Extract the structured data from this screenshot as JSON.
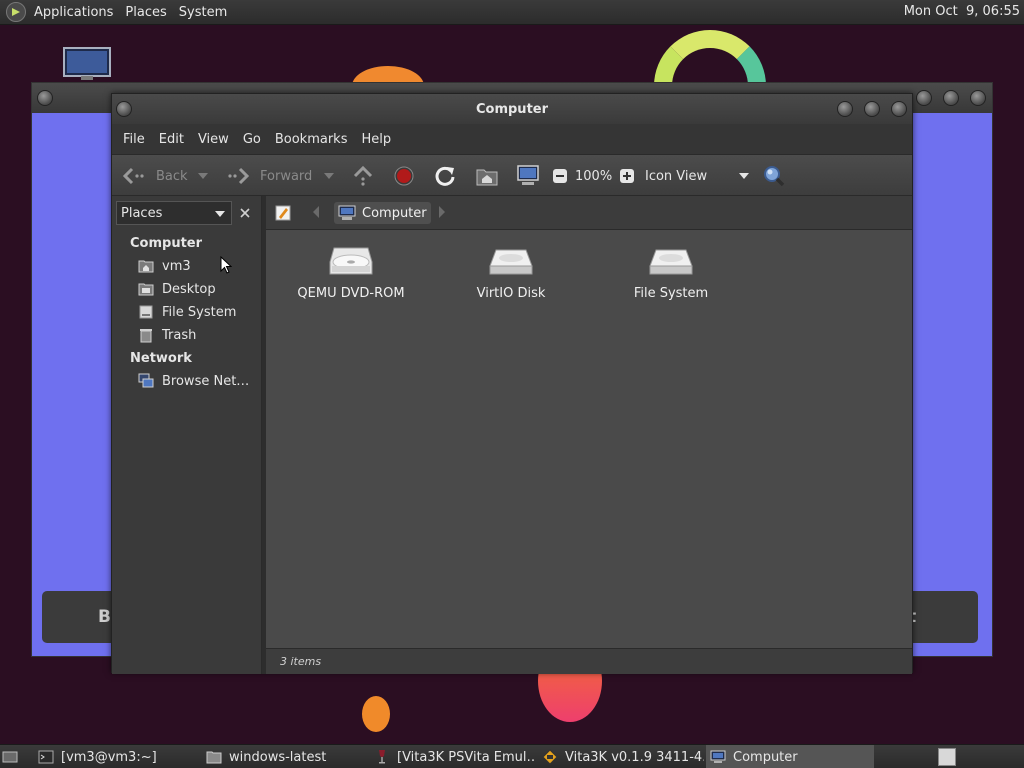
{
  "top_panel": {
    "menus": [
      "Applications",
      "Places",
      "System"
    ],
    "clock": "Mon Oct  9, 06:55"
  },
  "background_window": {
    "left_button_text": "B",
    "right_button_text": "t"
  },
  "window": {
    "title": "Computer",
    "menu": [
      "File",
      "Edit",
      "View",
      "Go",
      "Bookmarks",
      "Help"
    ],
    "toolbar": {
      "back": "Back",
      "forward": "Forward",
      "zoom": "100%",
      "view_mode": "Icon View"
    },
    "sidebar": {
      "selector": "Places",
      "sections": [
        {
          "heading": "Computer",
          "items": [
            "vm3",
            "Desktop",
            "File System",
            "Trash"
          ]
        },
        {
          "heading": "Network",
          "items": [
            "Browse Net…"
          ]
        }
      ]
    },
    "location": {
      "crumb": "Computer"
    },
    "files": [
      "QEMU DVD-ROM",
      "VirtIO Disk",
      "File System"
    ],
    "status": "3 items"
  },
  "taskbar": {
    "tasks": [
      "[vm3@vm3:~]",
      "windows-latest",
      "[Vita3K PSVita Emul…",
      "Vita3K v0.1.9 3411-4…",
      "Computer"
    ]
  },
  "colors": {
    "desktop": "#2b0e22",
    "bg_window": "#6f70ef",
    "icon_view": "#4a4a4a",
    "stop_red": "#b11a1a"
  }
}
